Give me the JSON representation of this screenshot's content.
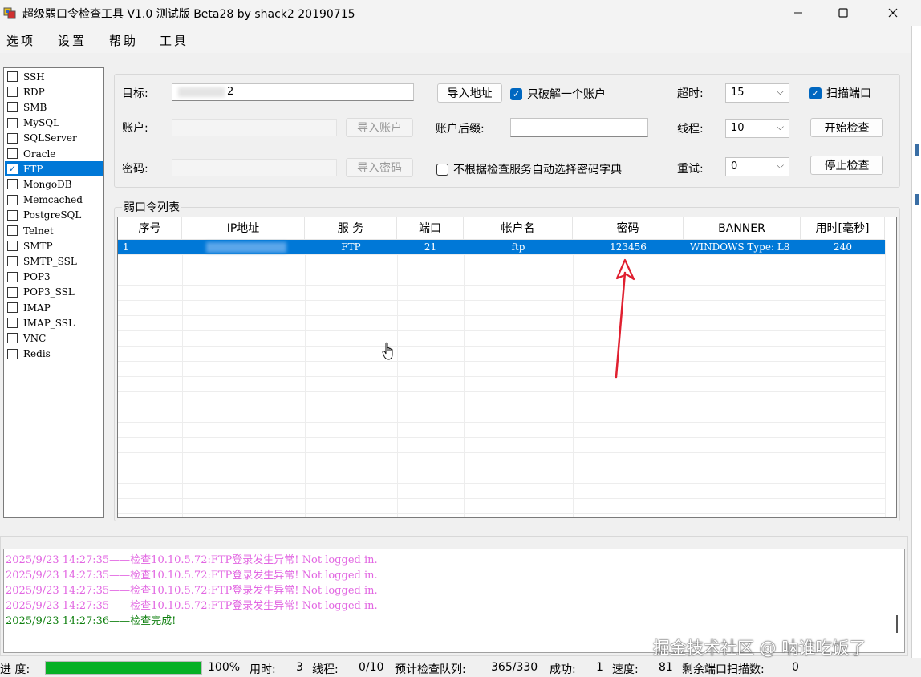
{
  "window": {
    "title": "超级弱口令检查工具 V1.0 测试版 Beta28 by shack2 20190715",
    "minimize_icon": "minimize-icon",
    "maximize_icon": "maximize-icon",
    "close_icon": "close-icon"
  },
  "menu": [
    "选项",
    "设置",
    "帮助",
    "工具"
  ],
  "protocols": [
    {
      "label": "SSH",
      "checked": false
    },
    {
      "label": "RDP",
      "checked": false
    },
    {
      "label": "SMB",
      "checked": false
    },
    {
      "label": "MySQL",
      "checked": false
    },
    {
      "label": "SQLServer",
      "checked": false
    },
    {
      "label": "Oracle",
      "checked": false
    },
    {
      "label": "FTP",
      "checked": true
    },
    {
      "label": "MongoDB",
      "checked": false
    },
    {
      "label": "Memcached",
      "checked": false
    },
    {
      "label": "PostgreSQL",
      "checked": false
    },
    {
      "label": "Telnet",
      "checked": false
    },
    {
      "label": "SMTP",
      "checked": false
    },
    {
      "label": "SMTP_SSL",
      "checked": false
    },
    {
      "label": "POP3",
      "checked": false
    },
    {
      "label": "POP3_SSL",
      "checked": false
    },
    {
      "label": "IMAP",
      "checked": false
    },
    {
      "label": "IMAP_SSL",
      "checked": false
    },
    {
      "label": "VNC",
      "checked": false
    },
    {
      "label": "Redis",
      "checked": false
    }
  ],
  "settings": {
    "target_label": "目标:",
    "target_value": "2",
    "account_label": "账户:",
    "password_label": "密码:",
    "import_address": "导入地址",
    "import_account": "导入账户",
    "import_password": "导入密码",
    "only_one_account_label": "只破解一个账户",
    "only_one_account_checked": true,
    "account_suffix_label": "账户后缀:",
    "no_auto_dict_label": "不根据检查服务自动选择密码字典",
    "no_auto_dict_checked": false,
    "timeout_label": "超时:",
    "timeout_value": "15",
    "threads_label": "线程:",
    "threads_value": "10",
    "retry_label": "重试:",
    "retry_value": "0",
    "scan_port_label": "扫描端口",
    "scan_port_checked": true,
    "start_check": "开始检查",
    "stop_check": "停止检查"
  },
  "results": {
    "legend": "弱口令列表",
    "columns": [
      "序号",
      "IP地址",
      "服 务",
      "端口",
      "帐户名",
      "密码",
      "BANNER",
      "用时[毫秒]"
    ],
    "rows": [
      [
        "1",
        "",
        "FTP",
        "21",
        "ftp",
        "123456",
        "WINDOWS Type: L8",
        "240"
      ]
    ]
  },
  "log": [
    {
      "text": "2025/9/23 14:27:35——检查10.10.5.72:FTP登录发生异常! Not logged in.",
      "color": "#e266e2"
    },
    {
      "text": "2025/9/23 14:27:35——检查10.10.5.72:FTP登录发生异常! Not logged in.",
      "color": "#e266e2"
    },
    {
      "text": "2025/9/23 14:27:35——检查10.10.5.72:FTP登录发生异常! Not logged in.",
      "color": "#e266e2"
    },
    {
      "text": "2025/9/23 14:27:35——检查10.10.5.72:FTP登录发生异常! Not logged in.",
      "color": "#e266e2"
    },
    {
      "text": "2025/9/23 14:27:36——检查完成!",
      "color": "#108010"
    }
  ],
  "status": {
    "progress_label": "进 度:",
    "progress_value": 1.0,
    "progress_text": "100%",
    "time_label": "用时:",
    "time_value": "3",
    "threads_label": "线程:",
    "threads_value": "0/10",
    "queue_label": "预计检查队列:",
    "queue_value": "365/330",
    "success_label": "成功:",
    "success_value": "1",
    "speed_label": "速度:",
    "speed_value": "81",
    "remaining_label": "剩余端口扫描数:",
    "remaining_value": "0"
  },
  "watermark": "掘金技术社区 @ 呐谁吃饭了",
  "colors": {
    "selection": "#0078d7",
    "progress": "#06b025",
    "annotation_arrow": "#e02030"
  }
}
